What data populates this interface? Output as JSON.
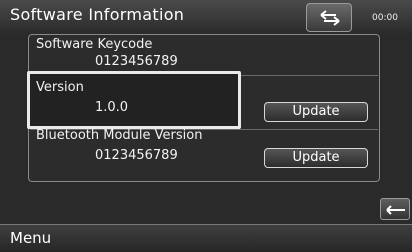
{
  "header": {
    "title": "Software Information",
    "clock": "00:00",
    "back_icon": "return-arrow-icon"
  },
  "rows": {
    "keycode": {
      "label": "Software Keycode",
      "value": "0123456789"
    },
    "version": {
      "label": "Version",
      "value": "1.0.0",
      "button_label": "Update"
    },
    "bluetooth": {
      "label": "Bluetooth Module Version",
      "value": "0123456789",
      "button_label": "Update"
    }
  },
  "footer": {
    "menu_label": "Menu",
    "side_icon": "collapse-arrow-icon"
  },
  "colors": {
    "background": "#2a2a2a",
    "text": "#f2f2f2",
    "highlight_border": "#eaeaea"
  }
}
